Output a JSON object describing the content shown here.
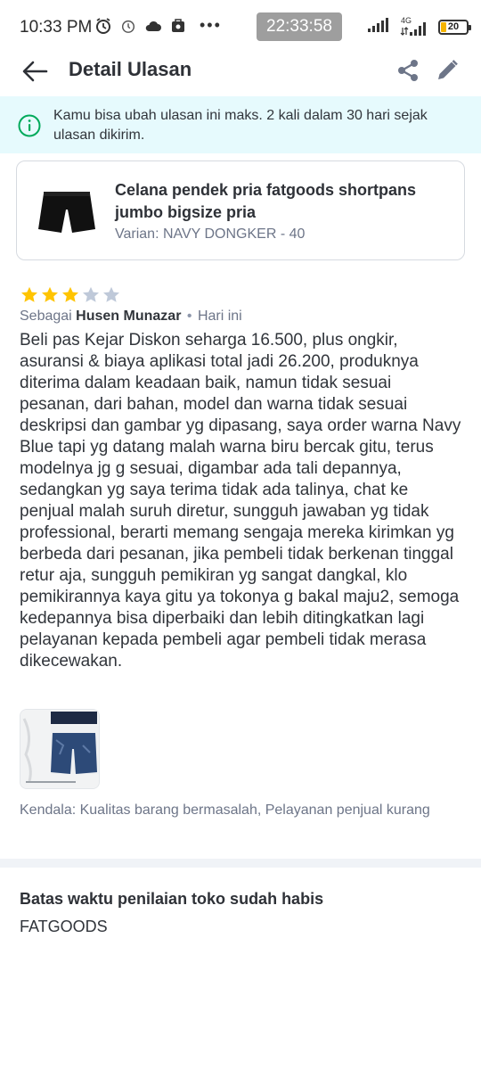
{
  "status_bar": {
    "time": "10:33 PM",
    "clock_overlay": "22:33:58",
    "network": "4G",
    "battery": "20",
    "icons": [
      "alarm-icon",
      "alarm-clock-icon",
      "cloud-icon",
      "notification-app-icon",
      "more-dots-icon",
      "signal-icon",
      "4g-signal-icon",
      "battery-icon"
    ]
  },
  "header": {
    "title": "Detail Ulasan"
  },
  "info_banner": {
    "text": "Kamu bisa ubah ulasan ini maks. 2 kali dalam 30 hari sejak ulasan dikirim."
  },
  "product": {
    "name": "Celana pendek pria fatgoods shortpans jumbo bigsize pria",
    "variant": "Varian: NAVY DONGKER - 40"
  },
  "review": {
    "rating": 3,
    "max_rating": 5,
    "reviewer_prefix": "Sebagai",
    "reviewer_name": "Husen Munazar",
    "separator": "•",
    "time": "Hari ini",
    "text": "Beli pas Kejar Diskon seharga 16.500, plus ongkir, asuransi & biaya aplikasi total jadi 26.200, produknya diterima dalam keadaan baik, namun tidak sesuai pesanan, dari bahan, model dan warna tidak sesuai deskripsi dan gambar yg dipasang, saya order warna Navy Blue tapi yg datang malah warna biru bercak gitu, terus modelnya jg g sesuai, digambar ada tali depannya, sedangkan yg saya terima tidak ada talinya, chat ke penjual malah suruh diretur, sungguh jawaban yg tidak professional, berarti memang sengaja mereka kirimkan yg berbeda dari pesanan, jika pembeli tidak berkenan tinggal retur aja, sungguh pemikiran yg sangat dangkal, klo pemikirannya kaya gitu ya tokonya g bakal maju2, semoga kedepannya bisa diperbaiki dan lebih ditingkatkan lagi pelayanan kepada pembeli agar pembeli tidak merasa dikecewakan.",
    "issues": "Kendala: Kualitas barang bermasalah, Pelayanan penjual kurang"
  },
  "deadline": {
    "title": "Batas waktu penilaian toko sudah habis",
    "shop": "FATGOODS"
  },
  "colors": {
    "star_filled": "#ffc400",
    "star_empty": "#bfc9d9",
    "banner_bg": "#e6fafd",
    "info_icon": "#00aa5b"
  }
}
